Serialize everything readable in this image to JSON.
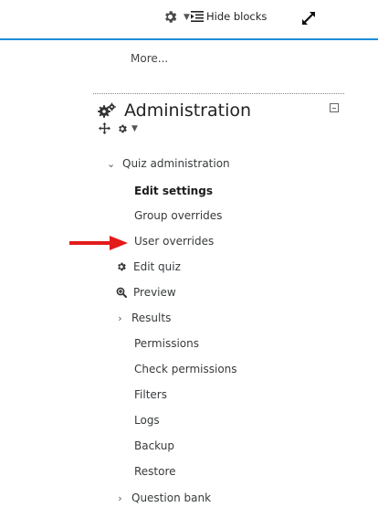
{
  "toolbar": {
    "hide_blocks_label": "Hide blocks"
  },
  "more_link": "More...",
  "block": {
    "title": "Administration"
  },
  "nav": {
    "quiz_administration": "Quiz administration",
    "edit_settings": "Edit settings",
    "group_overrides": "Group overrides",
    "user_overrides": "User overrides",
    "edit_quiz": "Edit quiz",
    "preview": "Preview",
    "results": "Results",
    "permissions": "Permissions",
    "check_permissions": "Check permissions",
    "filters": "Filters",
    "logs": "Logs",
    "backup": "Backup",
    "restore": "Restore",
    "question_bank": "Question bank"
  },
  "icons": {
    "toolbar_gear": "gear-icon",
    "hide_blocks": "hide-blocks-icon",
    "fullscreen": "expand-icon",
    "block_icon": "cogs-icon",
    "move": "move-icon",
    "actions": "gear-icon",
    "collapse": "minus-box-icon",
    "edit_quiz": "gear-icon",
    "preview": "zoom-icon",
    "annotation": "red-arrow"
  },
  "colors": {
    "accent_line": "#1f8dd6",
    "arrow": "#e31b1b"
  }
}
